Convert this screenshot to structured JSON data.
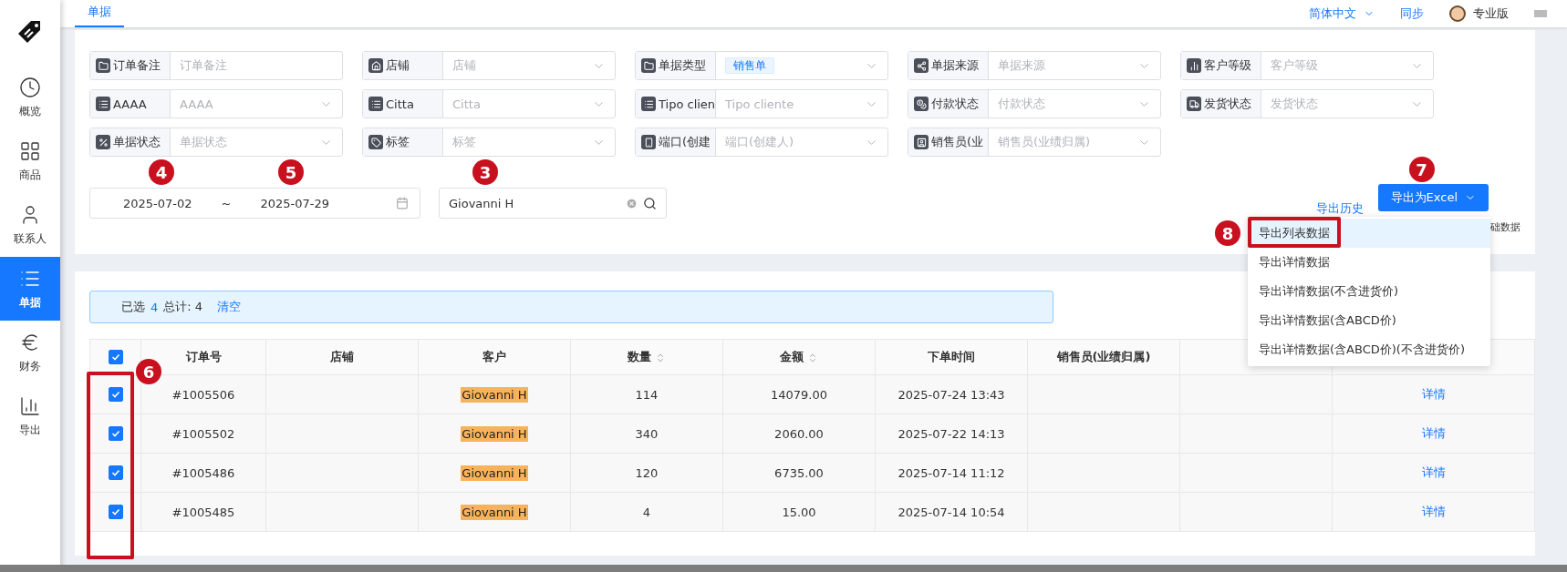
{
  "sidebar": {
    "items": [
      {
        "label": "概览",
        "selected": false
      },
      {
        "label": "商品",
        "selected": false
      },
      {
        "label": "联系人",
        "selected": false
      },
      {
        "label": "单据",
        "selected": true
      },
      {
        "label": "财务",
        "selected": false
      },
      {
        "label": "导出",
        "selected": false
      }
    ]
  },
  "top_bar": {
    "tabs": [
      {
        "label": "单据",
        "selected": true
      }
    ],
    "language": "简体中文",
    "sync": "同步",
    "plan": "专业版"
  },
  "filters": [
    {
      "label": "订单备注",
      "kind": "input",
      "placeholder": "订单备注"
    },
    {
      "label": "店铺",
      "kind": "select",
      "placeholder": "店铺"
    },
    {
      "label": "单据类型",
      "kind": "select",
      "value": "销售单"
    },
    {
      "label": "单据来源",
      "kind": "select",
      "placeholder": "单据来源"
    },
    {
      "label": "客户等级",
      "kind": "select",
      "placeholder": "客户等级"
    },
    {
      "label": "AAAA",
      "kind": "select",
      "placeholder": "AAAA"
    },
    {
      "label": "Citta",
      "kind": "select",
      "placeholder": "Citta"
    },
    {
      "label": "Tipo clien",
      "kind": "select",
      "placeholder": "Tipo cliente"
    },
    {
      "label": "付款状态",
      "kind": "select",
      "placeholder": "付款状态"
    },
    {
      "label": "发货状态",
      "kind": "select",
      "placeholder": "发货状态"
    },
    {
      "label": "单据状态",
      "kind": "select",
      "placeholder": "单据状态"
    },
    {
      "label": "标签",
      "kind": "select",
      "placeholder": "标签"
    },
    {
      "label": "端口(创建",
      "kind": "select",
      "placeholder": "端口(创建人)"
    },
    {
      "label": "销售员(业",
      "kind": "select",
      "placeholder": "销售员(业绩归属)"
    }
  ],
  "date_range": {
    "start": "2025-07-02",
    "separator": "~",
    "end": "2025-07-29"
  },
  "search": {
    "value": "Giovanni H"
  },
  "export": {
    "history": "导出历史",
    "button": "导出为Excel",
    "hidden_option_fragment": "础数据",
    "menu": [
      {
        "label": "导出列表数据",
        "selected": true
      },
      {
        "label": "导出详情数据",
        "selected": false
      },
      {
        "label": "导出详情数据(不含进货价)",
        "selected": false
      },
      {
        "label": "导出详情数据(含ABCD价)",
        "selected": false
      },
      {
        "label": "导出详情数据(含ABCD价)(不含进货价)",
        "selected": false
      }
    ]
  },
  "selection": {
    "label": "已选",
    "count": "4",
    "total": "总计: 4",
    "clear": "清空"
  },
  "table": {
    "all_checked": true,
    "columns": [
      {
        "label": "订单号",
        "sortable": false
      },
      {
        "label": "店铺",
        "sortable": false
      },
      {
        "label": "客户",
        "sortable": false
      },
      {
        "label": "数量",
        "sortable": true
      },
      {
        "label": "金额",
        "sortable": true
      },
      {
        "label": "下单时间",
        "sortable": false
      },
      {
        "label": "销售员(业绩归属)",
        "sortable": false
      }
    ],
    "rows": [
      {
        "checked": true,
        "order": "#1005506",
        "customer": "Giovanni H",
        "highlighted": true,
        "quantity": "114",
        "amount": "14079.00",
        "time": "2025-07-24 13:43",
        "action": "详情"
      },
      {
        "checked": true,
        "order": "#1005502",
        "customer": "Giovanni H",
        "highlighted": true,
        "quantity": "340",
        "amount": "2060.00",
        "time": "2025-07-22 14:13",
        "action": "详情"
      },
      {
        "checked": true,
        "order": "#1005486",
        "customer": "Giovanni H",
        "highlighted": true,
        "quantity": "120",
        "amount": "6735.00",
        "time": "2025-07-14 11:12",
        "action": "详情"
      },
      {
        "checked": true,
        "order": "#1005485",
        "customer": "Giovanni H",
        "highlighted": true,
        "quantity": "4",
        "amount": "15.00",
        "time": "2025-07-14 10:54",
        "action": "详情"
      }
    ]
  },
  "annotations": {
    "date_start": "4",
    "date_end": "5",
    "search": "3",
    "row_checkboxes": "6",
    "export_button": "7",
    "export_menu_item": "8"
  }
}
